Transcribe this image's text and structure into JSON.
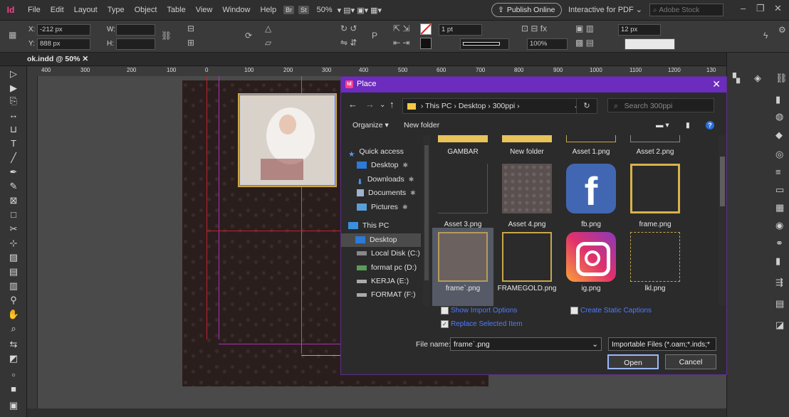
{
  "menubar": {
    "app_logo": "Id",
    "items": [
      "File",
      "Edit",
      "Layout",
      "Type",
      "Object",
      "Table",
      "View",
      "Window",
      "Help"
    ],
    "bridge_badge": "Br",
    "stock_badge": "St",
    "zoom": "50%",
    "publish_online": "Publish Online",
    "workspace": "Interactive for PDF",
    "stock_search_placeholder": "Adobe Stock"
  },
  "controlbar": {
    "x_label": "X:",
    "x_value": "-212 px",
    "y_label": "Y:",
    "y_value": "888 px",
    "w_label": "W:",
    "h_label": "H:",
    "stroke_weight": "1 pt",
    "opacity": "100%",
    "size_value": "12 px"
  },
  "document": {
    "tab_label": "ok.indd @ 50%"
  },
  "ruler": {
    "ticks": [
      "400",
      "300",
      "200",
      "100",
      "0",
      "100",
      "200",
      "300",
      "400",
      "500",
      "600",
      "700",
      "800",
      "900",
      "1000",
      "1100",
      "1200",
      "130"
    ]
  },
  "dialog": {
    "title": "Place",
    "address": [
      "This PC",
      "Desktop",
      "300ppi"
    ],
    "search_placeholder": "Search 300ppi",
    "organize": "Organize",
    "new_folder": "New folder",
    "nav": {
      "quick_access": "Quick access",
      "desktop": "Desktop",
      "downloads": "Downloads",
      "documents": "Documents",
      "pictures": "Pictures",
      "this_pc": "This PC",
      "desktop2": "Desktop",
      "local_disk": "Local Disk (C:)",
      "format_pc": "format pc (D:)",
      "kerja": "KERJA (E:)",
      "format_f": "FORMAT (F:)"
    },
    "files": {
      "gambar": "GAMBAR",
      "new_folder": "New folder",
      "asset1": "Asset 1.png",
      "asset2": "Asset 2.png",
      "asset3": "Asset 3.png",
      "asset4": "Asset 4.png",
      "fb": "fb.png",
      "frame": "frame.png",
      "frame_sel": "frame`.png",
      "framegold": "FRAMEGOLD.png",
      "ig": "ig.png",
      "lkl": "lkl.png"
    },
    "show_import_options": "Show Import Options",
    "create_static_captions": "Create Static Captions",
    "replace_selected_item": "Replace Selected Item",
    "file_name_label": "File name:",
    "file_name_value": "frame`.png",
    "file_type": "Importable Files (*.oam;*.inds;*",
    "open_button": "Open",
    "cancel_button": "Cancel"
  },
  "colors": {
    "dialog_title_bg": "#6c2cbd",
    "accent_blue": "#4f7bff",
    "indesign_pink": "#ff3f8e"
  }
}
